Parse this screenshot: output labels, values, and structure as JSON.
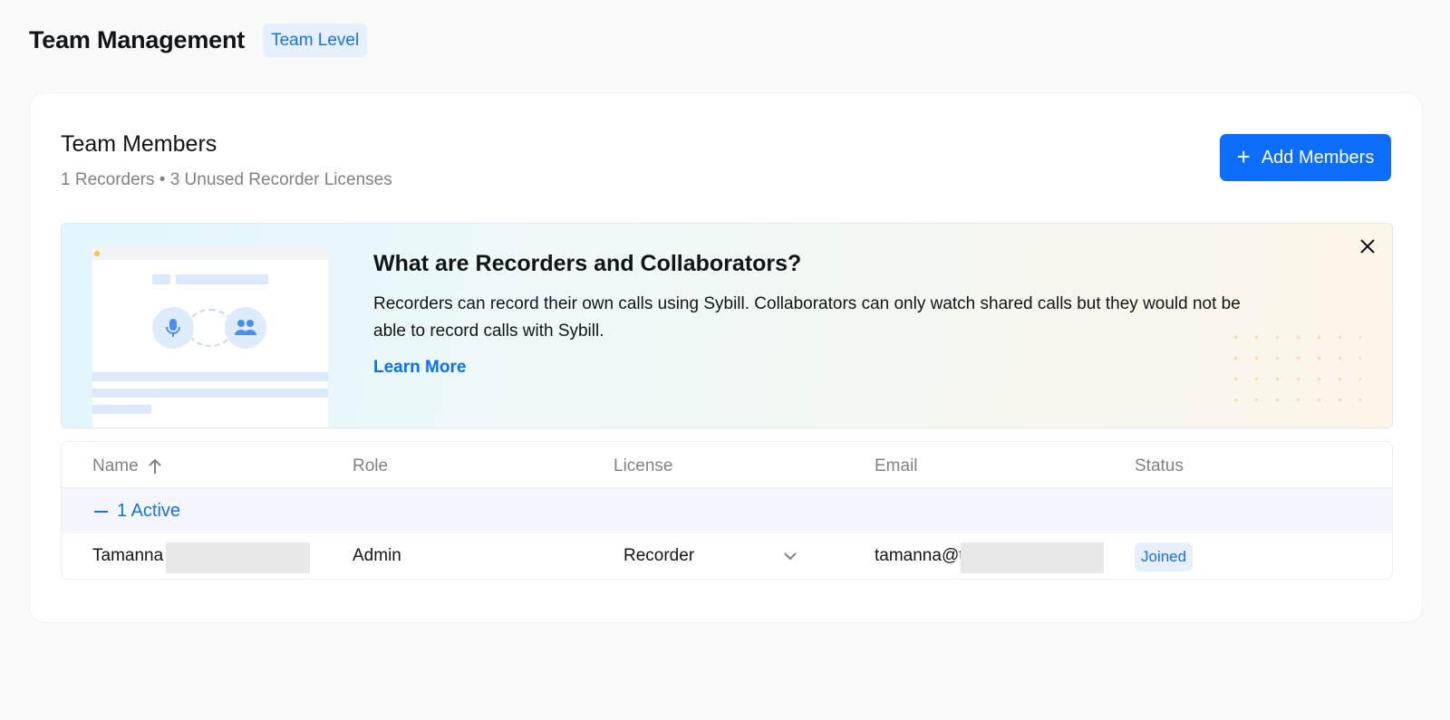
{
  "header": {
    "title": "Team Management",
    "level_badge": "Team Level"
  },
  "card": {
    "title": "Team Members",
    "subtitle": "1 Recorders • 3 Unused Recorder Licenses",
    "add_button_label": "Add Members"
  },
  "banner": {
    "title": "What are Recorders and Collaborators?",
    "body": "Recorders can record their own calls using Sybill. Collaborators can only watch shared calls but they would not be able to record calls with Sybill.",
    "link_label": "Learn More"
  },
  "table": {
    "columns": [
      "Name",
      "Role",
      "License",
      "Email",
      "Status"
    ],
    "sort_column": "Name",
    "sort_direction": "ascending",
    "group": {
      "label": "1 Active",
      "expanded": true
    },
    "rows": [
      {
        "name": "Tamanna",
        "role": "Admin",
        "license": "Recorder",
        "email": "tamanna@t",
        "status": "Joined"
      }
    ]
  },
  "icons": {
    "add": "plus-icon",
    "close": "close-icon",
    "sort": "arrow-up-icon",
    "collapse": "minus-icon",
    "dropdown": "chevron-down-icon",
    "recorder": "microphone-icon",
    "collaborator": "users-icon"
  },
  "colors": {
    "accent": "#0d6efd",
    "badge_bg": "#e6f0fd",
    "badge_text": "#1a6fe8",
    "muted_text": "#7d8289"
  }
}
